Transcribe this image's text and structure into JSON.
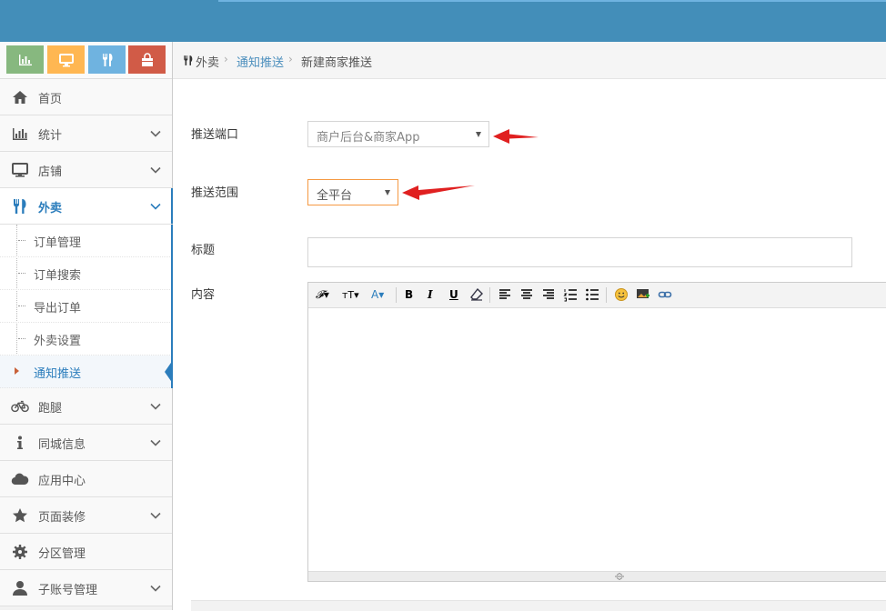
{
  "shortcuts": [
    {
      "icon": "bar-chart-icon",
      "color": "#87b87f"
    },
    {
      "icon": "desktop-icon",
      "color": "#ffb752"
    },
    {
      "icon": "cutlery-icon",
      "color": "#6fb3e0"
    },
    {
      "icon": "shopping-bag-icon",
      "color": "#d15b47"
    }
  ],
  "sidebar": {
    "items": [
      {
        "label": "首页",
        "icon": "home-icon"
      },
      {
        "label": "统计",
        "icon": "bar-chart-icon"
      },
      {
        "label": "店铺",
        "icon": "desktop-icon"
      },
      {
        "label": "外卖",
        "icon": "cutlery-icon",
        "active": true
      },
      {
        "label": "跑腿",
        "icon": "bicycle-icon"
      },
      {
        "label": "同城信息",
        "icon": "info-icon"
      },
      {
        "label": "应用中心",
        "icon": "cloud-icon"
      },
      {
        "label": "页面装修",
        "icon": "star-icon"
      },
      {
        "label": "分区管理",
        "icon": "gear-icon"
      },
      {
        "label": "子账号管理",
        "icon": "user-icon"
      }
    ],
    "submenu": [
      {
        "label": "订单管理"
      },
      {
        "label": "订单搜索"
      },
      {
        "label": "导出订单"
      },
      {
        "label": "外卖设置"
      },
      {
        "label": "通知推送",
        "active": true
      }
    ]
  },
  "breadcrumb": {
    "root": "外卖",
    "parent": "通知推送",
    "current": "新建商家推送"
  },
  "form": {
    "port_label": "推送端口",
    "port_value": "商户后台&商家App",
    "scope_label": "推送范围",
    "scope_value": "全平台",
    "title_label": "标题",
    "content_label": "内容"
  },
  "colors": {
    "topbar": "#438eb9",
    "accent": "#2b7dbc",
    "annotation_arrow": "#e02020"
  }
}
